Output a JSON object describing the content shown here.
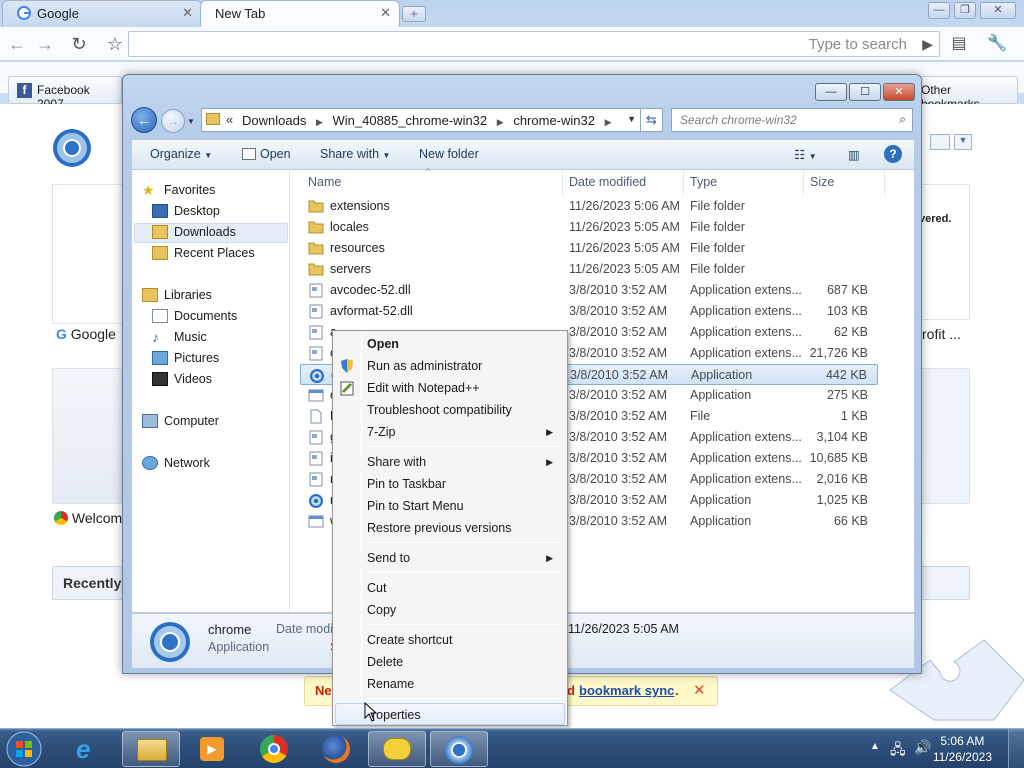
{
  "browser": {
    "tabs": [
      {
        "label": "Google",
        "active": false
      },
      {
        "label": "New Tab",
        "active": true
      }
    ],
    "omnibox": {
      "placeholder": "Type to search"
    },
    "bookmarks": {
      "left": "Facebook 2007",
      "right": "Other bookmarks"
    },
    "newtab": {
      "thumb1_label": "Google",
      "thumb2_label": "Welcom",
      "thumb_right_label": "rofit ...",
      "recently": "Recently",
      "right_snippet": "vered."
    },
    "sync_bar": {
      "left": "Ne",
      "middle": "d",
      "link": "bookmark sync",
      "trail": "."
    }
  },
  "explorer": {
    "breadcrumb": [
      "Downloads",
      "Win_40885_chrome-win32",
      "chrome-win32"
    ],
    "breadcrumb_prefix": "«",
    "search_placeholder": "Search chrome-win32",
    "commands": {
      "organize": "Organize",
      "open": "Open",
      "share": "Share with",
      "new_folder": "New folder"
    },
    "nav": {
      "favorites": "Favorites",
      "desktop": "Desktop",
      "downloads": "Downloads",
      "recent": "Recent Places",
      "libraries": "Libraries",
      "documents": "Documents",
      "music": "Music",
      "pictures": "Pictures",
      "videos": "Videos",
      "computer": "Computer",
      "network": "Network"
    },
    "columns": {
      "name": "Name",
      "date": "Date modified",
      "type": "Type",
      "size": "Size"
    },
    "files": [
      {
        "name": "extensions",
        "date": "11/26/2023 5:06 AM",
        "type": "File folder",
        "size": "",
        "icon": "folder"
      },
      {
        "name": "locales",
        "date": "11/26/2023 5:05 AM",
        "type": "File folder",
        "size": "",
        "icon": "folder"
      },
      {
        "name": "resources",
        "date": "11/26/2023 5:05 AM",
        "type": "File folder",
        "size": "",
        "icon": "folder"
      },
      {
        "name": "servers",
        "date": "11/26/2023 5:05 AM",
        "type": "File folder",
        "size": "",
        "icon": "folder"
      },
      {
        "name": "avcodec-52.dll",
        "date": "3/8/2010 3:52 AM",
        "type": "Application extens...",
        "size": "687 KB",
        "icon": "dll"
      },
      {
        "name": "avformat-52.dll",
        "date": "3/8/2010 3:52 AM",
        "type": "Application extens...",
        "size": "103 KB",
        "icon": "dll"
      },
      {
        "name": "a",
        "date": "3/8/2010 3:52 AM",
        "type": "Application extens...",
        "size": "62 KB",
        "icon": "dll"
      },
      {
        "name": "c",
        "date": "3/8/2010 3:52 AM",
        "type": "Application extens...",
        "size": "21,726 KB",
        "icon": "dll"
      },
      {
        "name": "c",
        "date": "3/8/2010 3:52 AM",
        "type": "Application",
        "size": "442 KB",
        "icon": "chrome",
        "selected": true
      },
      {
        "name": "c",
        "date": "3/8/2010 3:52 AM",
        "type": "Application",
        "size": "275 KB",
        "icon": "app"
      },
      {
        "name": "F",
        "date": "3/8/2010 3:52 AM",
        "type": "File",
        "size": "1 KB",
        "icon": "file"
      },
      {
        "name": "g",
        "date": "3/8/2010 3:52 AM",
        "type": "Application extens...",
        "size": "3,104 KB",
        "icon": "dll"
      },
      {
        "name": "i",
        "date": "3/8/2010 3:52 AM",
        "type": "Application extens...",
        "size": "10,685 KB",
        "icon": "dll"
      },
      {
        "name": "n",
        "date": "3/8/2010 3:52 AM",
        "type": "Application extens...",
        "size": "2,016 KB",
        "icon": "dll"
      },
      {
        "name": "n",
        "date": "3/8/2010 3:52 AM",
        "type": "Application",
        "size": "1,025 KB",
        "icon": "chrome"
      },
      {
        "name": "w",
        "date": "3/8/2010 3:52 AM",
        "type": "Application",
        "size": "66 KB",
        "icon": "app"
      }
    ],
    "details": {
      "name": "chrome",
      "type": "Application",
      "date_label": "Date modif",
      "date_value": "11/26/2023 5:05 AM",
      "s_label": "S"
    }
  },
  "context_menu": {
    "open": "Open",
    "run_as_admin": "Run as administrator",
    "edit_notepad": "Edit with Notepad++",
    "troubleshoot": "Troubleshoot compatibility",
    "seven_zip": "7-Zip",
    "share_with": "Share with",
    "pin_taskbar": "Pin to Taskbar",
    "pin_start": "Pin to Start Menu",
    "restore": "Restore previous versions",
    "send_to": "Send to",
    "cut": "Cut",
    "copy": "Copy",
    "create_shortcut": "Create shortcut",
    "delete": "Delete",
    "rename": "Rename",
    "properties": "roperties"
  },
  "taskbar": {
    "time": "5:06 AM",
    "date": "11/26/2023"
  },
  "colors": {
    "accent": "#3a6ea5",
    "selection": "#cfe2f7",
    "sync_red": "#cc2200",
    "sync_link": "#1a4fb0"
  }
}
